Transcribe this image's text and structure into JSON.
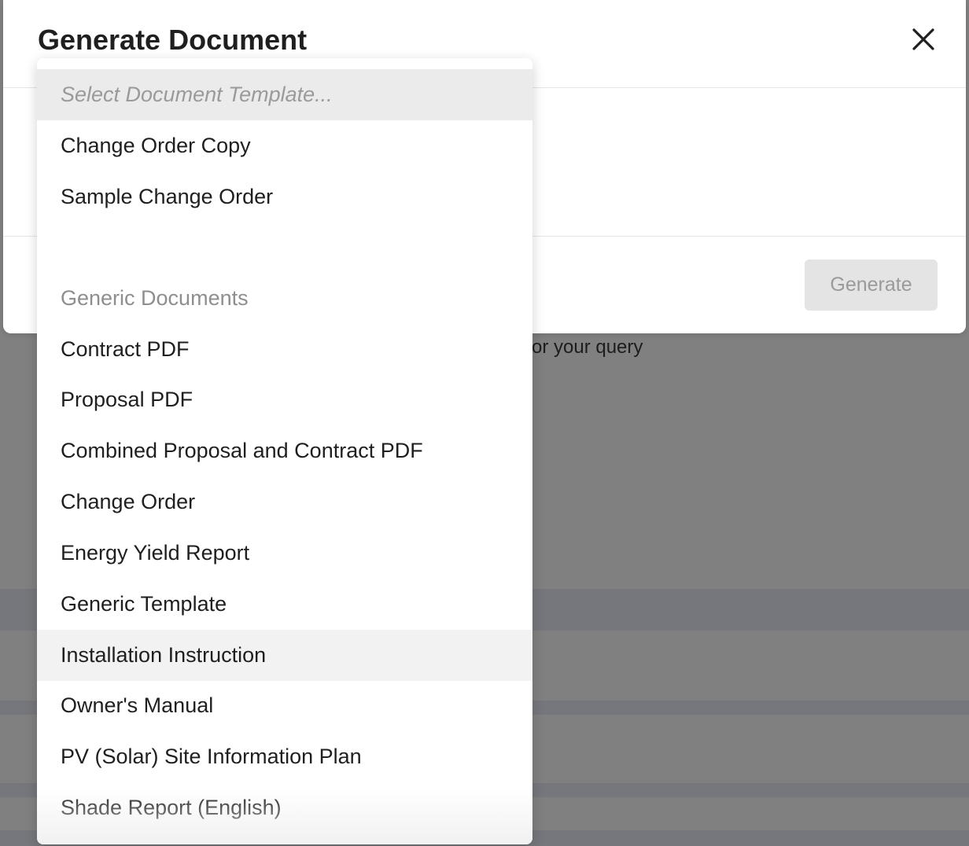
{
  "background": {
    "partial_text": "or your query"
  },
  "modal": {
    "title": "Generate Document",
    "generate_label": "Generate"
  },
  "dropdown": {
    "placeholder": "Select Document Template...",
    "items": [
      "Change Order Copy",
      "Sample Change Order"
    ],
    "group_label": "Generic Documents",
    "group_items": [
      "Contract PDF",
      "Proposal PDF",
      "Combined Proposal and Contract PDF",
      "Change Order",
      "Energy Yield Report",
      "Generic Template",
      "Installation Instruction",
      "Owner's Manual",
      "PV (Solar) Site Information Plan",
      "Shade Report (English)"
    ],
    "highlighted_item": "Installation Instruction"
  },
  "colors": {
    "overlay": "#808080",
    "disabled_button": "#e4e4e4",
    "placeholder_bg": "#ebebeb",
    "hover_bg": "#f2f2f2"
  }
}
